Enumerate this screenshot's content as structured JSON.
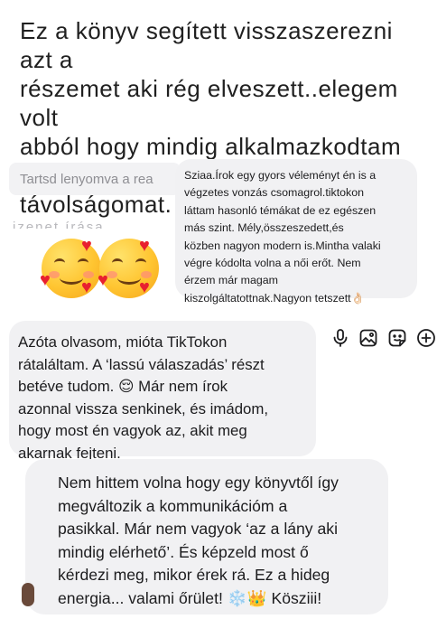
{
  "messages": {
    "top": "Ez a könyv segített visszaszerezni azt a\nrészemet aki rég elveszett..elegem volt\nabból hogy mindig alkalmazkodtam\nmost már értéknek látom a\ntávolságomat. Köszönöm!❤️",
    "review": "Sziaa.Írok egy gyors véleményt én is a\nvégzetes vonzás csomagrol.tiktokon\nláttam hasonló témákat de ez egészen\nmás szint. Mély,összeszedett,és\nközben nagyon modern is.Mintha valaki\nvégre kódolta volna a női erőt. Nem\nérzem már magam\nkiszolgáltatottnak.Nagyon tetszett👌🏻",
    "middle": "Azóta olvasom, mióta TikTokon\nrátaláltam. A ‘lassú válaszadás’ részt\nbetéve tudom. 😌 Már nem írok\nazonnal vissza senkinek, és imádom,\nhogy most én vagyok az, akit meg\nakarnak fejteni.",
    "bottom": "Nem hittem volna hogy egy könyvtől így\nmegváltozik a kommunikációm a\npasikkal. Már nem vagyok ‘az a lány aki\nmindig elérhető’. És képzeld most ő\nkérdezi meg, mikor érek rá. Ez a hideg\nenergia... valami őrület! ❄️👑 Kösziii!"
  },
  "input": {
    "placeholder": "Tartsd lenyomva a rea"
  },
  "background_text": "izenet írása",
  "toolbar": {
    "icons": [
      "microphone-icon",
      "image-icon",
      "sticker-icon",
      "plus-icon"
    ]
  },
  "colors": {
    "bubble": "#f1f1f3",
    "heart": "#e8202f",
    "text": "#1c1c1e"
  }
}
